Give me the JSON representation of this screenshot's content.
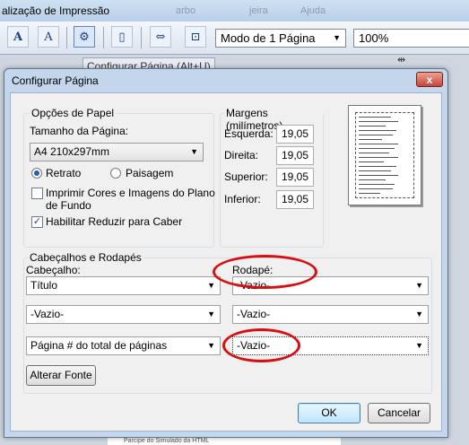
{
  "app": {
    "title": "alização de Impressão",
    "faded_items": [
      "arbo",
      "jeira",
      "Ajuda"
    ]
  },
  "toolbar": {
    "layout_mode": "Modo de 1 Página",
    "zoom": "100%",
    "tooltip": "Configurar Página (Alt+U)"
  },
  "background": {
    "status_text": "Parcipe do Simulado da HTML"
  },
  "dialog": {
    "title": "Configurar Página",
    "close_label": "x",
    "paper": {
      "group_title": "Opções de Papel",
      "size_label": "Tamanho da Página:",
      "size_value": "A4 210x297mm",
      "portrait_label": "Retrato",
      "landscape_label": "Paisagem",
      "portrait_selected": true,
      "print_bg_label_1": "Imprimir Cores e Imagens do Plano",
      "print_bg_label_2": "de Fundo",
      "print_bg_checked": false,
      "shrink_label": "Habilitar Reduzir para Caber",
      "shrink_checked": true
    },
    "margins": {
      "group_title": "Margens (milímetros)",
      "left_label": "Esquerda:",
      "left_value": "19,05",
      "right_label": "Direita:",
      "right_value": "19,05",
      "top_label": "Superior:",
      "top_value": "19,05",
      "bottom_label": "Inferior:",
      "bottom_value": "19,05"
    },
    "headers": {
      "group_title": "Cabeçalhos e Rodapés",
      "header_label": "Cabeçalho:",
      "footer_label": "Rodapé:",
      "header_1": "Título",
      "header_2": "-Vazio-",
      "header_3": "Página # do total de páginas",
      "footer_1": "-Vazio-",
      "footer_2": "-Vazio-",
      "footer_3": "-Vazio-",
      "font_button": "Alterar Fonte"
    },
    "ok": "OK",
    "cancel": "Cancelar"
  },
  "annotation_color": "#d90f0f"
}
